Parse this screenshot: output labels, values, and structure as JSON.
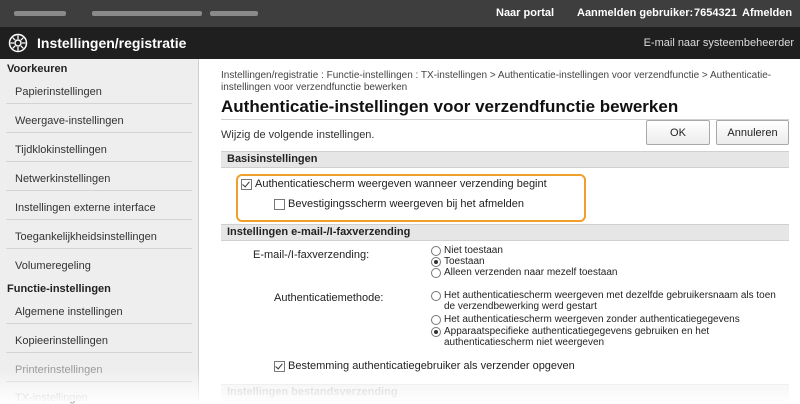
{
  "topbar": {
    "portal": "Naar portal",
    "login_user": "Aanmelden gebruiker:",
    "user_id": "7654321",
    "logout": "Afmelden"
  },
  "header": {
    "title": "Instellingen/registratie",
    "email_admin": "E-mail naar systeembeheerder"
  },
  "sidebar": {
    "group1": "Voorkeuren",
    "items1": [
      "Papierinstellingen",
      "Weergave-instellingen",
      "Tijdklokinstellingen",
      "Netwerkinstellingen",
      "Instellingen externe interface",
      "Toegankelijkheidsinstellingen",
      "Volumeregeling"
    ],
    "group2": "Functie-instellingen",
    "items2": [
      "Algemene instellingen",
      "Kopieerinstellingen",
      "Printerinstellingen",
      "TX-instellingen"
    ]
  },
  "breadcrumb": "Instellingen/registratie : Functie-instellingen : TX-instellingen > Authenticatie-instellingen voor verzendfunctie > Authenticatie-instellingen voor verzendfunctie bewerken",
  "page_title": "Authenticatie-instellingen voor verzendfunctie bewerken",
  "intro": "Wijzig de volgende instellingen.",
  "buttons": {
    "ok": "OK",
    "cancel": "Annuleren"
  },
  "basic": {
    "heading": "Basisinstellingen",
    "show_auth_screen": "Authenticatiescherm weergeven wanneer verzending begint",
    "show_confirm_logout": "Bevestigingsscherm weergeven bij het afmelden",
    "show_auth_screen_checked": true,
    "show_confirm_logout_checked": false
  },
  "email_fax": {
    "heading": "Instellingen e-mail-/I-faxverzending",
    "sending_label": "E-mail-/I-faxverzending:",
    "sending_options": [
      "Niet toestaan",
      "Toestaan",
      "Alleen verzenden naar mezelf toestaan"
    ],
    "sending_selected": 1,
    "auth_method_label": "Authenticatiemethode:",
    "auth_options": [
      "Het authenticatiescherm weergeven met dezelfde gebruikersnaam als toen de verzendbewerking werd gestart",
      "Het authenticatiescherm weergeven zonder authenticatiegegevens",
      "Apparaatspecifieke authenticatiegegevens gebruiken en het authenticatiescherm niet weergeven"
    ],
    "auth_selected": 2,
    "specify_auth_user": "Bestemming authenticatiegebruiker als verzender opgeven",
    "specify_auth_user_checked": true
  },
  "folder": {
    "heading": "Instellingen bestandsverzending"
  }
}
